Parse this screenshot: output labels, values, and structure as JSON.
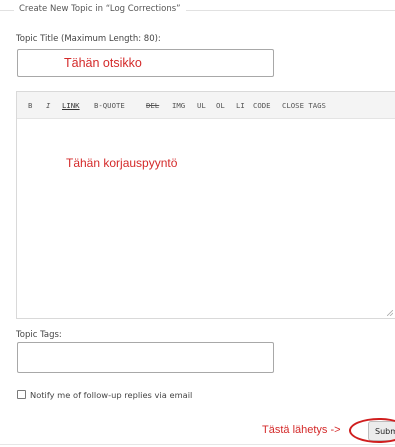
{
  "form": {
    "legend": "Create New Topic in “Log Corrections”",
    "title_label": "Topic Title (Maximum Length: 80):",
    "title_value": "",
    "tags_label": "Topic Tags:",
    "tags_value": "",
    "notify_label": "Notify me of follow-up replies via email",
    "notify_checked": false,
    "submit_label": "Submit"
  },
  "toolbar": {
    "buttons": [
      "B",
      "I",
      "LINK",
      "B-QUOTE",
      "DEL",
      "IMG",
      "UL",
      "OL",
      "LI",
      "CODE",
      "CLOSE TAGS"
    ]
  },
  "editor": {
    "content": ""
  },
  "annotations": {
    "title_hint": "Tähän otsikko",
    "body_hint": "Tähän korjauspyyntö",
    "submit_hint": "Tästä lähetys ->",
    "color": "#d42a2a"
  }
}
